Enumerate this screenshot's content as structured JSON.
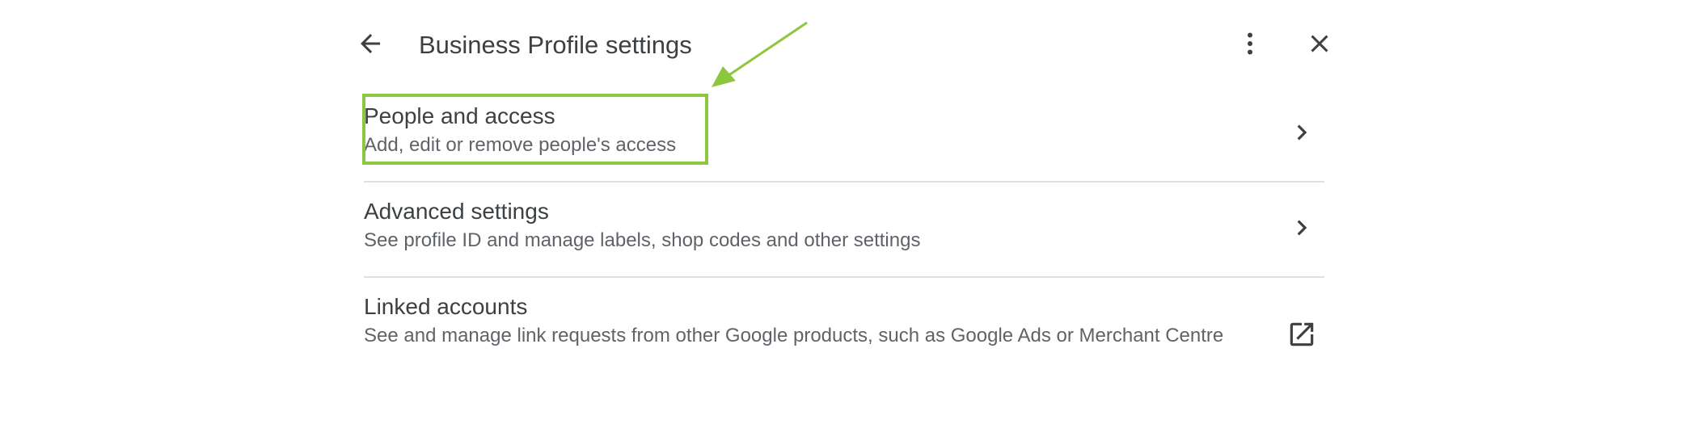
{
  "header": {
    "title": "Business Profile settings"
  },
  "items": [
    {
      "title": "People and access",
      "subtitle": "Add, edit or remove people's access",
      "trailing_icon": "chevron-right-icon"
    },
    {
      "title": "Advanced settings",
      "subtitle": "See profile ID and manage labels, shop codes and other settings",
      "trailing_icon": "chevron-right-icon"
    },
    {
      "title": "Linked accounts",
      "subtitle": "See and manage link requests from other Google products, such as Google Ads or Merchant Centre",
      "trailing_icon": "open-in-new-icon"
    }
  ],
  "annotation": {
    "color": "#8dc63f"
  },
  "colors": {
    "text_primary": "#3c4043",
    "text_secondary": "#5f6368",
    "divider": "#e0e0e0"
  }
}
